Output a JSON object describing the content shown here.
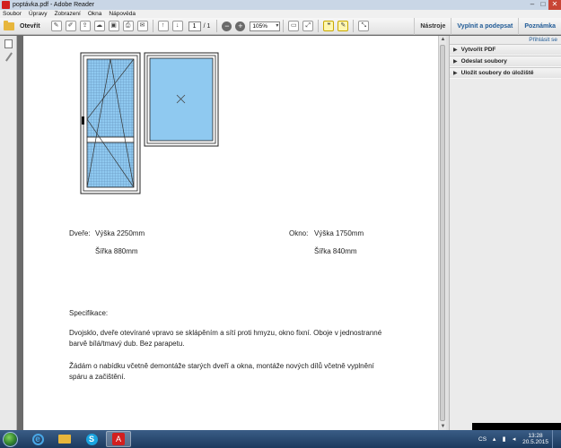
{
  "window": {
    "title": "poptávka.pdf - Adobe Reader",
    "minimize": "–",
    "maximize": "□",
    "close": "✕"
  },
  "menu": [
    "Soubor",
    "Úpravy",
    "Zobrazení",
    "Okna",
    "Nápověda"
  ],
  "toolbar": {
    "open_label": "Otevřít",
    "page_current": "1",
    "page_total": "/ 1",
    "zoom": "105%",
    "tools_label": "Nástroje",
    "sign_label": "Vyplnit a podepsat",
    "comment_label": "Poznámka"
  },
  "right_panel": {
    "attach_label": "Přihlásit se",
    "items": [
      "Vytvořit PDF",
      "Odeslat soubory",
      "Uložit soubory do úložiště"
    ]
  },
  "document": {
    "door_label": "Dveře:",
    "door_height": "Výška 2250mm",
    "door_width": "Šířka 880mm",
    "window_label": "Okno:",
    "window_height": "Výška 1750mm",
    "window_width": "Šířka 840mm",
    "spec_heading": "Specifikace:",
    "spec_para1": "Dvojsklo, dveře otevírané vpravo se sklápěním a sítí proti hmyzu, okno fixní. Oboje v jednostranné barvě bílá/tmavý dub. Bez parapetu.",
    "spec_para2": "Žádám o nabídku včetně demontáže starých dveří a okna, montáže nových dílů včetně vyplnění spáru a začištění."
  },
  "taskbar": {
    "language": "CS",
    "time": "13:28",
    "date": "20.5.2015",
    "acrobat_glyph": "A",
    "skype_glyph": "S",
    "ie_glyph": "e"
  },
  "colors": {
    "glass": "#8fc9f0",
    "frame": "#ffffff",
    "accent_blue": "#1f5a96",
    "adobe_red": "#d21f1f"
  }
}
